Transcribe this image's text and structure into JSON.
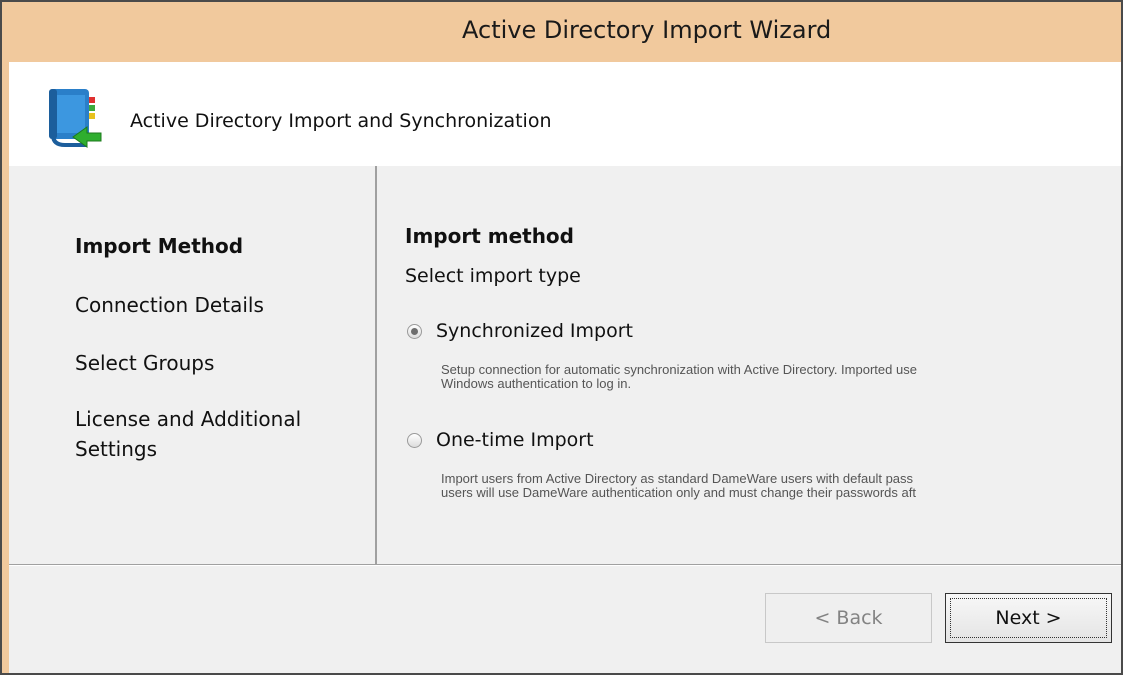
{
  "window": {
    "title": "Active Directory Import Wizard"
  },
  "banner": {
    "icon": "address-book-import-icon",
    "title": "Active Directory Import and Synchronization"
  },
  "steps": [
    {
      "label": "Import Method",
      "active": true
    },
    {
      "label": "Connection Details",
      "active": false
    },
    {
      "label": "Select Groups",
      "active": false
    },
    {
      "label": "License and Additional",
      "active": false
    },
    {
      "label": "Settings",
      "active": false
    }
  ],
  "content": {
    "heading": "Import method",
    "subheading": "Select import type",
    "options": [
      {
        "label": "Synchronized Import",
        "checked": true,
        "description_line1": "Setup connection for automatic synchronization with Active Directory. Imported use",
        "description_line2": "Windows authentication to log in."
      },
      {
        "label": "One-time Import",
        "checked": false,
        "description_line1": "Import users from Active Directory as standard DameWare users with default pass",
        "description_line2": "users will use DameWare authentication only and must change their passwords aft"
      }
    ]
  },
  "buttons": {
    "back": "< Back",
    "next": "Next >"
  },
  "colors": {
    "titlebar": "#f1c99d",
    "dialog": "#f0f0f0",
    "banner": "#ffffff"
  }
}
